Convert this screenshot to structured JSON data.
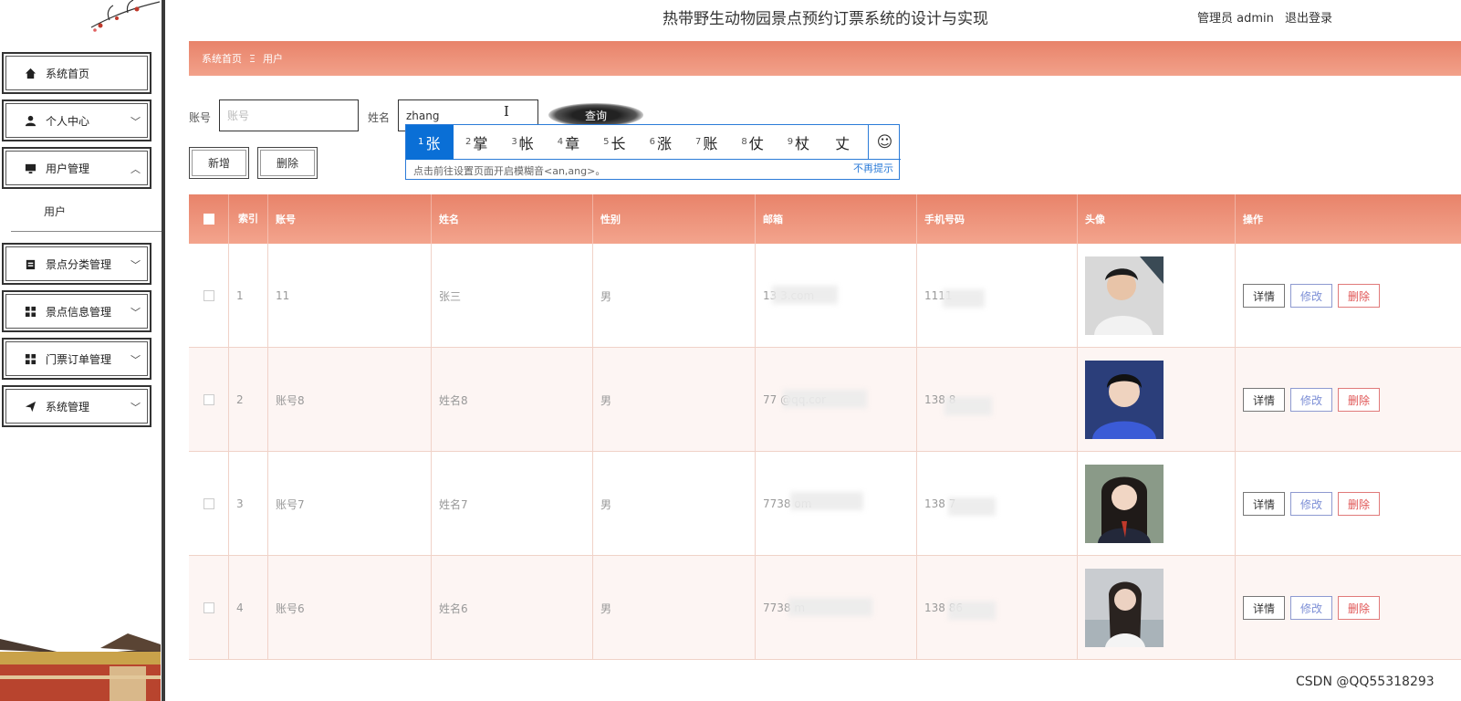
{
  "header": {
    "title": "热带野生动物园景点预约订票系统的设计与实现",
    "user_role": "管理员 admin",
    "logout": "退出登录"
  },
  "sidebar": {
    "items": [
      {
        "label": "系统首页",
        "icon": "home-icon"
      },
      {
        "label": "个人中心",
        "icon": "person-icon"
      },
      {
        "label": "用户管理",
        "icon": "monitor-icon"
      },
      {
        "label": "景点分类管理",
        "icon": "clipboard-icon"
      },
      {
        "label": "景点信息管理",
        "icon": "grid-icon"
      },
      {
        "label": "门票订单管理",
        "icon": "grid-icon"
      },
      {
        "label": "系统管理",
        "icon": "send-icon"
      }
    ],
    "sub_item": "用户"
  },
  "breadcrumb": {
    "home": "系统首页",
    "separator": "Ξ",
    "current": "用户"
  },
  "search": {
    "account_label": "账号",
    "account_placeholder": "账号",
    "name_label": "姓名",
    "name_value": "zhang",
    "query_button": "查询"
  },
  "ime": {
    "candidates": [
      {
        "n": "1",
        "c": "张"
      },
      {
        "n": "2",
        "c": "掌"
      },
      {
        "n": "3",
        "c": "帐"
      },
      {
        "n": "4",
        "c": "章"
      },
      {
        "n": "5",
        "c": "长"
      },
      {
        "n": "6",
        "c": "涨"
      },
      {
        "n": "7",
        "c": "账"
      },
      {
        "n": "8",
        "c": "仗"
      },
      {
        "n": "9",
        "c": "杖"
      },
      {
        "n": "",
        "c": "丈"
      }
    ],
    "emoji": "☺",
    "hint": "点击前往设置页面开启模糊音<an,ang>。",
    "dismiss": "不再提示"
  },
  "actions": {
    "add": "新增",
    "delete": "删除"
  },
  "table": {
    "headers": [
      "",
      "索引",
      "账号",
      "姓名",
      "性别",
      "邮箱",
      "手机号码",
      "头像",
      "操作"
    ],
    "rows": [
      {
        "index": "1",
        "account": "11",
        "name": "张三",
        "gender": "男",
        "email": "13        3.com",
        "phone": "        1111"
      },
      {
        "index": "2",
        "account": "账号8",
        "name": "姓名8",
        "gender": "男",
        "email": "77        @qq.cor",
        "phone": "138        8"
      },
      {
        "index": "3",
        "account": "账号7",
        "name": "姓名7",
        "gender": "男",
        "email": "7738        om",
        "phone": "138        7"
      },
      {
        "index": "4",
        "account": "账号6",
        "name": "姓名6",
        "gender": "男",
        "email": "7738        m",
        "phone": "138        86"
      }
    ],
    "ops": {
      "detail": "详情",
      "edit": "修改",
      "remove": "删除"
    }
  },
  "watermark": "CSDN @QQ55318293"
}
